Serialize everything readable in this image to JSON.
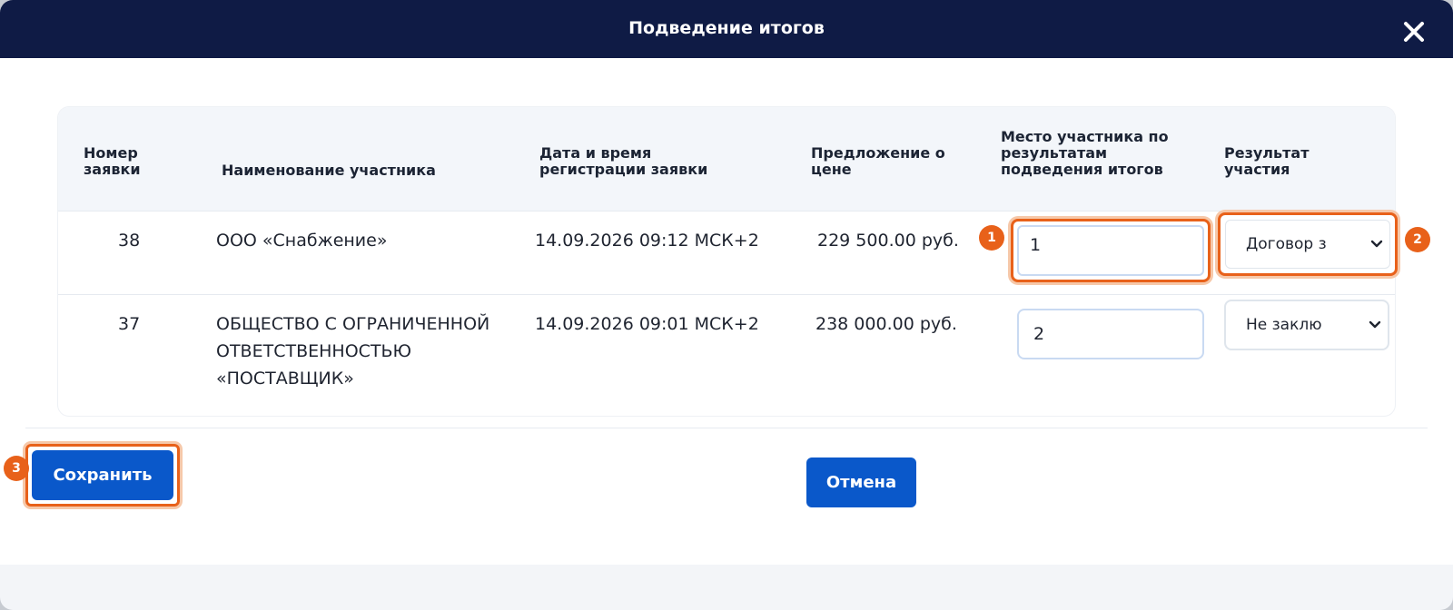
{
  "dialog": {
    "title": "Подведение итогов",
    "close_icon": "close-icon"
  },
  "table": {
    "headers": {
      "number": "Номер заявки",
      "participant": "Наименование участника",
      "datetime": "Дата и время регистрации заявки",
      "price": "Предложение о цене",
      "place": "Место участника по результатам подведения итогов",
      "result": "Результат участия"
    },
    "rows": [
      {
        "number": "38",
        "participant": "ООО «Снабжение»",
        "datetime": "14.09.2026 09:12 МСК+2",
        "price": "229 500.00 руб.",
        "place": "1",
        "result": "Договор з"
      },
      {
        "number": "37",
        "participant": "ОБЩЕСТВО С ОГРАНИЧЕННОЙ ОТВЕТСТВЕННОСТЬЮ «ПОСТАВЩИК»",
        "datetime": "14.09.2026 09:01 МСК+2",
        "price": "238 000.00 руб.",
        "place": "2",
        "result": "Не заклю"
      }
    ]
  },
  "badges": [
    "1",
    "2",
    "3"
  ],
  "buttons": {
    "save": "Сохранить",
    "cancel": "Отмена"
  },
  "colors": {
    "titlebar": "#0f1b45",
    "primary": "#0a58ca",
    "highlight": "#e8611a"
  }
}
